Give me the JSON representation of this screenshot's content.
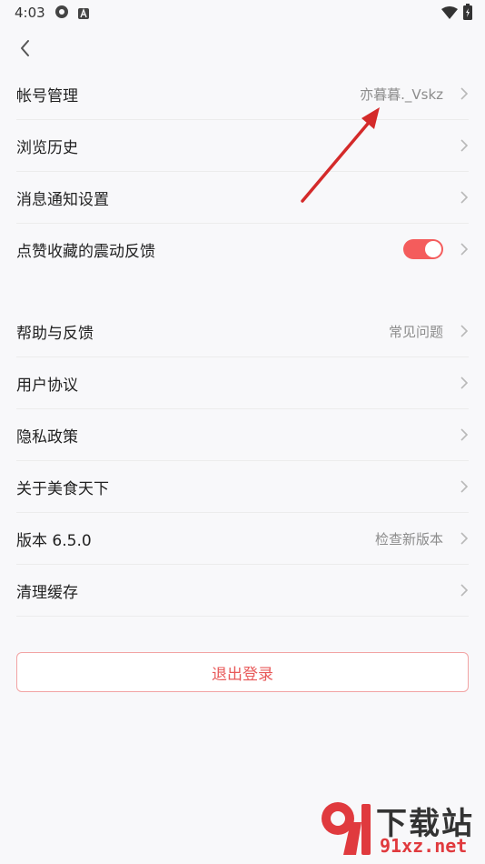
{
  "status_bar": {
    "time": "4:03"
  },
  "settings": {
    "group1": [
      {
        "label": "帐号管理",
        "value": "亦暮暮._Vskz"
      },
      {
        "label": "浏览历史",
        "value": ""
      },
      {
        "label": "消息通知设置",
        "value": ""
      },
      {
        "label": "点赞收藏的震动反馈",
        "value": ""
      }
    ],
    "vibration_feedback": {
      "on": true
    },
    "group2": [
      {
        "label": "帮助与反馈",
        "value": "常见问题"
      },
      {
        "label": "用户协议",
        "value": ""
      },
      {
        "label": "隐私政策",
        "value": ""
      },
      {
        "label": "关于美食天下",
        "value": ""
      },
      {
        "label": "版本 6.5.0",
        "value": "检查新版本"
      },
      {
        "label": "清理缓存",
        "value": ""
      }
    ]
  },
  "logout": {
    "label": "退出登录"
  },
  "watermark": {
    "top": "下载站",
    "bottom": "91xz.net"
  },
  "colors": {
    "accent": "#f45c5c",
    "logout_text": "#e85a5a",
    "arrow": "#d42a2a"
  }
}
